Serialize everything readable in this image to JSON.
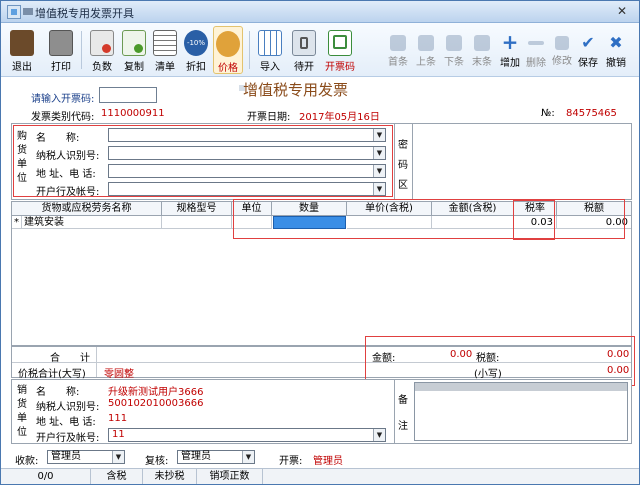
{
  "window": {
    "title": "增值税专用发票开具"
  },
  "toolbar": {
    "buttons": [
      {
        "label": "退出",
        "icon": "exit-door-icon"
      },
      {
        "label": "打印",
        "icon": "printer-icon"
      },
      {
        "label": "负数",
        "icon": "negative-invoice-icon"
      },
      {
        "label": "复制",
        "icon": "copy-icon"
      },
      {
        "label": "清单",
        "icon": "list-icon"
      },
      {
        "label": "折扣",
        "icon": "discount-icon"
      },
      {
        "label": "价格",
        "icon": "price-icon"
      },
      {
        "label": "导入",
        "icon": "import-icon"
      },
      {
        "label": "待开",
        "icon": "pending-icon"
      },
      {
        "label": "开票码",
        "icon": "invoice-code-icon"
      },
      {
        "label": "首条",
        "icon": "first-record-icon"
      },
      {
        "label": "上条",
        "icon": "previous-record-icon"
      },
      {
        "label": "下条",
        "icon": "next-record-icon"
      },
      {
        "label": "末条",
        "icon": "last-record-icon"
      },
      {
        "label": "增加",
        "icon": "add-row-icon"
      },
      {
        "label": "删除",
        "icon": "delete-row-icon"
      },
      {
        "label": "修改",
        "icon": "edit-icon"
      },
      {
        "label": "保存",
        "icon": "save-check-icon"
      },
      {
        "label": "撤销",
        "icon": "undo-x-icon"
      }
    ]
  },
  "header": {
    "code_prompt": "请输入开票码:",
    "invoice_title": "增值税专用发票",
    "category_code_label": "发票类别代码:",
    "category_code_value": "1110000911",
    "date_label": "开票日期:",
    "date_value": "2017年05月16日",
    "number_label": "№:",
    "number_value": "84575465"
  },
  "buyer": {
    "side_label": "购货单位",
    "fields": [
      "名　　称:",
      "纳税人识别号:",
      "地 址、电 话:",
      "开户行及帐号:"
    ],
    "cipher_label": "密码区"
  },
  "grid": {
    "columns": [
      "货物或应税劳务名称",
      "规格型号",
      "单位",
      "数量",
      "单价(含税)",
      "金额(含税)",
      "税率",
      "税额"
    ],
    "rows": [
      {
        "marker": "*",
        "name": "建筑安装",
        "spec": "",
        "unit": "",
        "qty": "",
        "price": "",
        "amount": "",
        "rate": "0.03",
        "tax": "0.00"
      }
    ]
  },
  "totals": {
    "subtotal_label": "合　　计",
    "amount_label": "金额:",
    "amount_value": "0.00",
    "tax_label": "税额:",
    "tax_value": "0.00",
    "in_words_label": "价税合计(大写)",
    "in_words_value": "零圆整",
    "small_label": "(小写)",
    "small_value": "0.00"
  },
  "seller": {
    "side_label": "销货单位",
    "name_label": "名　　称:",
    "name_value": "升级新测试用户3666",
    "taxid_label": "纳税人识别号:",
    "taxid_value": "500102010003666",
    "address_label": "地 址、电 话:",
    "address_value": "111",
    "bank_label": "开户行及帐号:",
    "bank_value": "11",
    "remark_label": "备注"
  },
  "signoff": {
    "payee_label": "收款:",
    "payee_value": "管理员",
    "reviewer_label": "复核:",
    "reviewer_value": "管理员",
    "issuer_label": "开票:",
    "issuer_value": "管理员"
  },
  "statusbar": [
    "0/0",
    "含税",
    "未抄税",
    "销项正数"
  ]
}
